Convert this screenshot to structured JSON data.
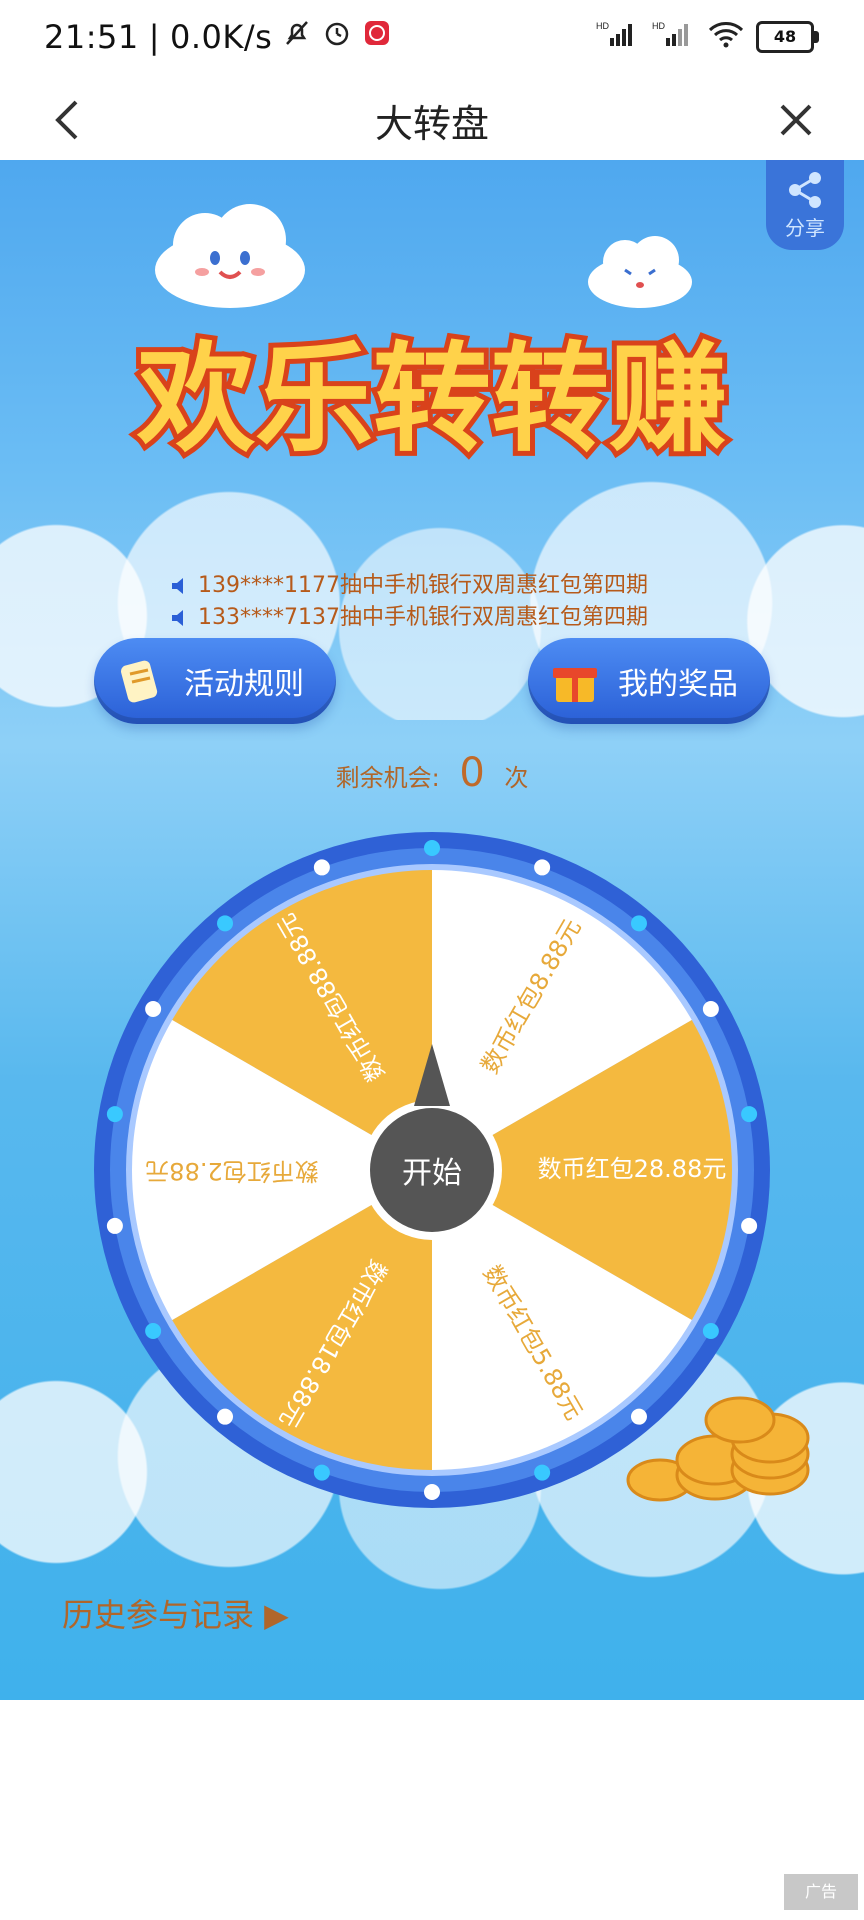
{
  "status_bar": {
    "time": "21:51",
    "network_speed": "0.0K/s",
    "signal_1": "HD",
    "signal_2": "HD",
    "battery": "48"
  },
  "nav": {
    "title": "大转盘",
    "back_icon": "chevron-left-icon",
    "close_icon": "close-icon"
  },
  "share": {
    "label": "分享",
    "icon": "share-icon"
  },
  "banner": {
    "title": "欢乐转转赚"
  },
  "ticker": [
    "139****1177抽中手机银行双周惠红包第四期",
    "133****7137抽中手机银行双周惠红包第四期"
  ],
  "buttons": {
    "rules": "活动规则",
    "prizes": "我的奖品"
  },
  "chances": {
    "label": "剩余机会:",
    "count": "0",
    "unit": "次"
  },
  "wheel": {
    "start_label": "开始",
    "prizes": [
      "数币红包88.88元",
      "数币红包8.88元",
      "数币红包28.88元",
      "数币红包5.88元",
      "数币红包18.88元",
      "数币红包2.88元"
    ]
  },
  "history": {
    "label": "历史参与记录 ▶"
  },
  "ad_label": "广告",
  "colors": {
    "accent_blue": "#2a5fd6",
    "wheel_gold": "#f4b93f",
    "text_brown": "#b0662a"
  }
}
